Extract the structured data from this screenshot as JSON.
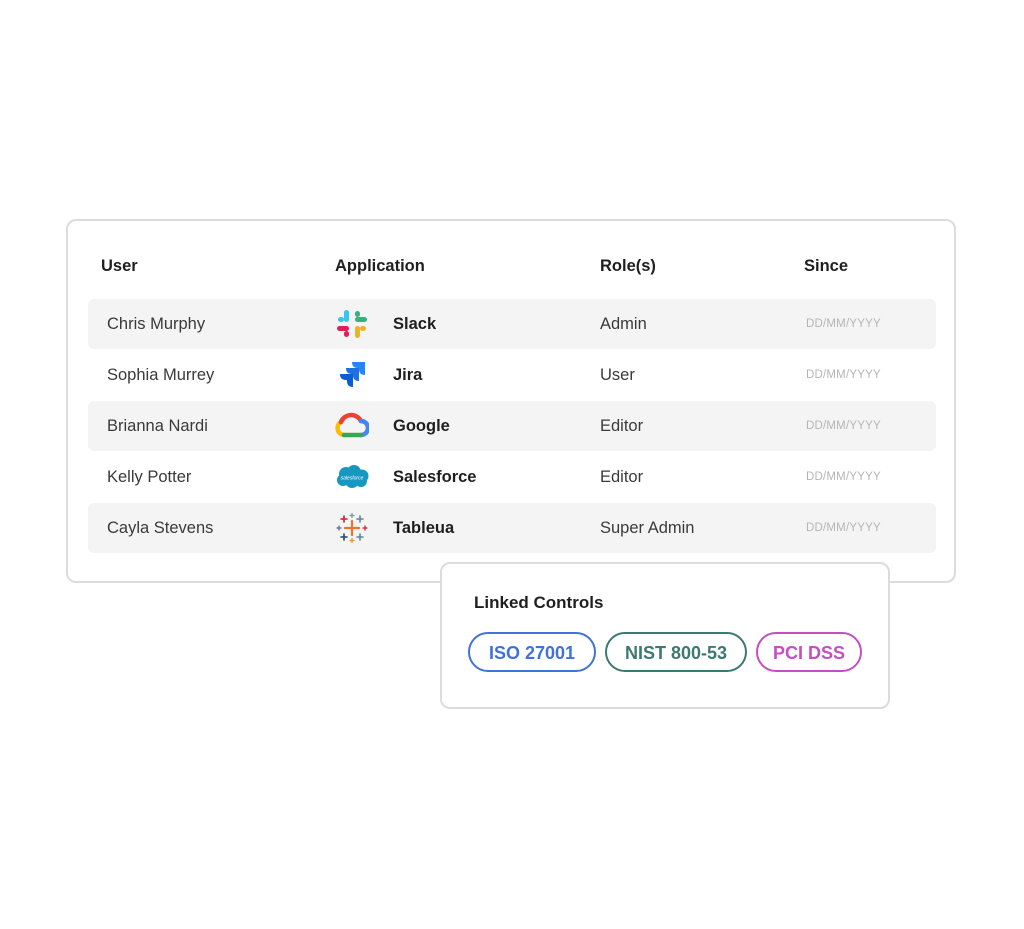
{
  "table": {
    "headers": {
      "user": "User",
      "application": "Application",
      "roles": "Role(s)",
      "since": "Since"
    },
    "rows": [
      {
        "user": "Chris Murphy",
        "app": "Slack",
        "app_icon": "slack-icon",
        "role": "Admin",
        "since": "DD/MM/YYYY"
      },
      {
        "user": "Sophia Murrey",
        "app": "Jira",
        "app_icon": "jira-icon",
        "role": "User",
        "since": "DD/MM/YYYY"
      },
      {
        "user": "Brianna Nardi",
        "app": "Google",
        "app_icon": "google-cloud-icon",
        "role": "Editor",
        "since": "DD/MM/YYYY"
      },
      {
        "user": "Kelly Potter",
        "app": "Salesforce",
        "app_icon": "salesforce-icon",
        "role": "Editor",
        "since": "DD/MM/YYYY"
      },
      {
        "user": "Cayla Stevens",
        "app": "Tableua",
        "app_icon": "tableau-icon",
        "role": "Super Admin",
        "since": "DD/MM/YYYY"
      }
    ]
  },
  "linked_controls": {
    "title": "Linked Controls",
    "tags": [
      {
        "label": "ISO 27001",
        "color": "#3f73d9"
      },
      {
        "label": "NIST 800-53",
        "color": "#3b7a70"
      },
      {
        "label": "PCI DSS",
        "color": "#c44fc2"
      }
    ]
  },
  "colors": {
    "row_shade": "#f4f4f4",
    "card_border": "#dcdcdc",
    "placeholder_text": "#b5b5b5",
    "salesforce_blue": "#1798c1",
    "jira_blue": "#2684ff"
  }
}
